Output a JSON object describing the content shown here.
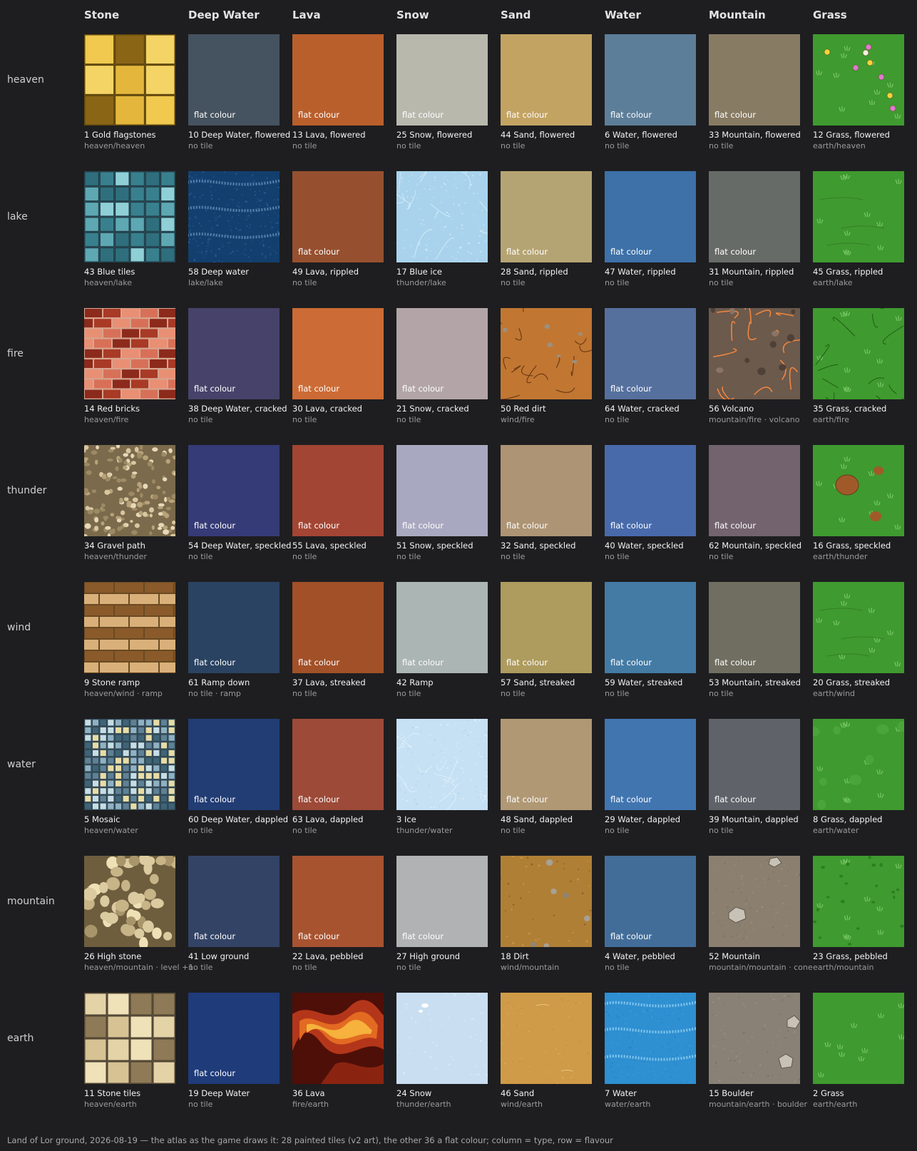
{
  "columns": [
    "Stone",
    "Deep Water",
    "Lava",
    "Snow",
    "Sand",
    "Water",
    "Mountain",
    "Grass"
  ],
  "rows": [
    {
      "label": "heaven",
      "cells": [
        {
          "name": "1  Gold flagstones",
          "source": "heaven/heaven",
          "flat": false,
          "icon": "gold-flagstones"
        },
        {
          "name": "10  Deep Water, flowered",
          "source": "no tile",
          "flat": true,
          "color": "#45525f"
        },
        {
          "name": "13  Lava, flowered",
          "source": "no tile",
          "flat": true,
          "color": "#b95f2c"
        },
        {
          "name": "25  Snow, flowered",
          "source": "no tile",
          "flat": true,
          "color": "#b9b8ad"
        },
        {
          "name": "44  Sand, flowered",
          "source": "no tile",
          "flat": true,
          "color": "#c3a362"
        },
        {
          "name": "6  Water, flowered",
          "source": "no tile",
          "flat": true,
          "color": "#5d7e99"
        },
        {
          "name": "33  Mountain, flowered",
          "source": "no tile",
          "flat": true,
          "color": "#887b63"
        },
        {
          "name": "12  Grass, flowered",
          "source": "earth/heaven",
          "flat": false,
          "icon": "grass-flowered"
        }
      ]
    },
    {
      "label": "lake",
      "cells": [
        {
          "name": "43  Blue tiles",
          "source": "heaven/lake",
          "flat": false,
          "icon": "blue-tiles"
        },
        {
          "name": "58  Deep water",
          "source": "lake/lake",
          "flat": false,
          "icon": "deep-water"
        },
        {
          "name": "49  Lava, rippled",
          "source": "no tile",
          "flat": true,
          "color": "#96502f"
        },
        {
          "name": "17  Blue ice",
          "source": "thunder/lake",
          "flat": false,
          "icon": "blue-ice"
        },
        {
          "name": "28  Sand, rippled",
          "source": "no tile",
          "flat": true,
          "color": "#b5a473"
        },
        {
          "name": "47  Water, rippled",
          "source": "no tile",
          "flat": true,
          "color": "#3d71a8"
        },
        {
          "name": "31  Mountain, rippled",
          "source": "no tile",
          "flat": true,
          "color": "#676b68"
        },
        {
          "name": "45  Grass, rippled",
          "source": "earth/lake",
          "flat": false,
          "icon": "grass-rippled"
        }
      ]
    },
    {
      "label": "fire",
      "cells": [
        {
          "name": "14  Red bricks",
          "source": "heaven/fire",
          "flat": false,
          "icon": "red-bricks"
        },
        {
          "name": "38  Deep Water, cracked",
          "source": "no tile",
          "flat": true,
          "color": "#47426a"
        },
        {
          "name": "30  Lava, cracked",
          "source": "no tile",
          "flat": true,
          "color": "#cc6b35"
        },
        {
          "name": "21  Snow, cracked",
          "source": "no tile",
          "flat": true,
          "color": "#b3a5a7"
        },
        {
          "name": "50  Red dirt",
          "source": "wind/fire",
          "flat": false,
          "icon": "red-dirt"
        },
        {
          "name": "64  Water, cracked",
          "source": "no tile",
          "flat": true,
          "color": "#56709e"
        },
        {
          "name": "56  Volcano",
          "source": "mountain/fire · volcano",
          "flat": false,
          "icon": "volcano"
        },
        {
          "name": "35  Grass, cracked",
          "source": "earth/fire",
          "flat": false,
          "icon": "grass-cracked"
        }
      ]
    },
    {
      "label": "thunder",
      "cells": [
        {
          "name": "34  Gravel path",
          "source": "heaven/thunder",
          "flat": false,
          "icon": "gravel-path"
        },
        {
          "name": "54  Deep Water, speckled",
          "source": "no tile",
          "flat": true,
          "color": "#353b76"
        },
        {
          "name": "55  Lava, speckled",
          "source": "no tile",
          "flat": true,
          "color": "#a34534"
        },
        {
          "name": "51  Snow, speckled",
          "source": "no tile",
          "flat": true,
          "color": "#a8a8c0"
        },
        {
          "name": "32  Sand, speckled",
          "source": "no tile",
          "flat": true,
          "color": "#ad9474"
        },
        {
          "name": "40  Water, speckled",
          "source": "no tile",
          "flat": true,
          "color": "#486aab"
        },
        {
          "name": "62  Mountain, speckled",
          "source": "no tile",
          "flat": true,
          "color": "#72636f"
        },
        {
          "name": "16  Grass, speckled",
          "source": "earth/thunder",
          "flat": false,
          "icon": "grass-speckled"
        }
      ]
    },
    {
      "label": "wind",
      "cells": [
        {
          "name": "9  Stone ramp",
          "source": "heaven/wind · ramp",
          "flat": false,
          "icon": "stone-ramp"
        },
        {
          "name": "61  Ramp down",
          "source": "no tile · ramp",
          "flat": true,
          "color": "#2a4362"
        },
        {
          "name": "37  Lava, streaked",
          "source": "no tile",
          "flat": true,
          "color": "#a25028"
        },
        {
          "name": "42  Ramp",
          "source": "no tile",
          "flat": true,
          "color": "#abb5b3"
        },
        {
          "name": "57  Sand, streaked",
          "source": "no tile",
          "flat": true,
          "color": "#ae9b5e"
        },
        {
          "name": "59  Water, streaked",
          "source": "no tile",
          "flat": true,
          "color": "#437ba5"
        },
        {
          "name": "53  Mountain, streaked",
          "source": "no tile",
          "flat": true,
          "color": "#6f6e61"
        },
        {
          "name": "20  Grass, streaked",
          "source": "earth/wind",
          "flat": false,
          "icon": "grass-streaked"
        }
      ]
    },
    {
      "label": "water",
      "cells": [
        {
          "name": "5  Mosaic",
          "source": "heaven/water",
          "flat": false,
          "icon": "mosaic"
        },
        {
          "name": "60  Deep Water, dappled",
          "source": "no tile",
          "flat": true,
          "color": "#213d74"
        },
        {
          "name": "63  Lava, dappled",
          "source": "no tile",
          "flat": true,
          "color": "#9d4a38"
        },
        {
          "name": "3  Ice",
          "source": "thunder/water",
          "flat": false,
          "icon": "ice"
        },
        {
          "name": "48  Sand, dappled",
          "source": "no tile",
          "flat": true,
          "color": "#b09875"
        },
        {
          "name": "29  Water, dappled",
          "source": "no tile",
          "flat": true,
          "color": "#4175b0"
        },
        {
          "name": "39  Mountain, dappled",
          "source": "no tile",
          "flat": true,
          "color": "#5f6369"
        },
        {
          "name": "8  Grass, dappled",
          "source": "earth/water",
          "flat": false,
          "icon": "grass-dappled"
        }
      ]
    },
    {
      "label": "mountain",
      "cells": [
        {
          "name": "26  High stone",
          "source": "heaven/mountain · level +1",
          "flat": false,
          "icon": "high-stone"
        },
        {
          "name": "41  Low ground",
          "source": "no tile",
          "flat": true,
          "color": "#324366"
        },
        {
          "name": "22  Lava, pebbled",
          "source": "no tile",
          "flat": true,
          "color": "#a85330"
        },
        {
          "name": "27  High ground",
          "source": "no tile",
          "flat": true,
          "color": "#b1b2b4"
        },
        {
          "name": "18  Dirt",
          "source": "wind/mountain",
          "flat": false,
          "icon": "dirt"
        },
        {
          "name": "4  Water, pebbled",
          "source": "no tile",
          "flat": true,
          "color": "#436d99"
        },
        {
          "name": "52  Mountain",
          "source": "mountain/mountain · cone",
          "flat": false,
          "icon": "mountain"
        },
        {
          "name": "23  Grass, pebbled",
          "source": "earth/mountain",
          "flat": false,
          "icon": "grass-pebbled"
        }
      ]
    },
    {
      "label": "earth",
      "cells": [
        {
          "name": "11  Stone tiles",
          "source": "heaven/earth",
          "flat": false,
          "icon": "stone-tiles"
        },
        {
          "name": "19  Deep Water",
          "source": "no tile",
          "flat": true,
          "color": "#1f3b7a"
        },
        {
          "name": "36  Lava",
          "source": "fire/earth",
          "flat": false,
          "icon": "lava"
        },
        {
          "name": "24  Snow",
          "source": "thunder/earth",
          "flat": false,
          "icon": "snow"
        },
        {
          "name": "46  Sand",
          "source": "wind/earth",
          "flat": false,
          "icon": "sand"
        },
        {
          "name": "7  Water",
          "source": "water/earth",
          "flat": false,
          "icon": "water"
        },
        {
          "name": "15  Boulder",
          "source": "mountain/earth · boulder",
          "flat": false,
          "icon": "boulder"
        },
        {
          "name": "2  Grass",
          "source": "earth/earth",
          "flat": false,
          "icon": "grass"
        }
      ]
    }
  ],
  "flat_label": "flat colour",
  "footer": "Land of Lor ground, 2026-08-19 — the atlas as the game draws it: 28 painted tiles (v2 art), the other 36 a flat colour; column = type, row = flavour"
}
